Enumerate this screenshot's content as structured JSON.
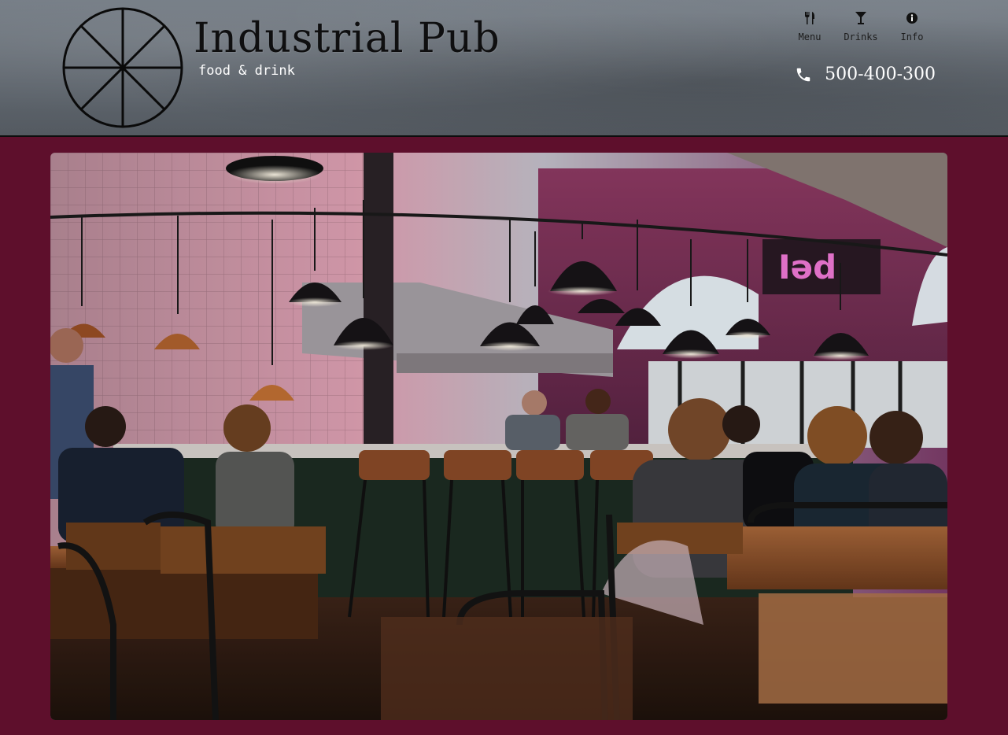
{
  "brand": {
    "title": "Industrial Pub",
    "tagline": "food & drink"
  },
  "nav": {
    "items": [
      {
        "label": "Menu",
        "icon": "utensils-icon"
      },
      {
        "label": "Drinks",
        "icon": "cocktail-glass-icon"
      },
      {
        "label": "Info",
        "icon": "info-circle-icon"
      }
    ]
  },
  "contact": {
    "phone": "500-400-300",
    "icon": "phone-icon"
  },
  "hero": {
    "image": "pub-interior-photo"
  },
  "colors": {
    "page_background": "#5e0f2c",
    "header_background": "#646b73",
    "title_text": "#0f0f10",
    "tagline_text": "#ffffff",
    "phone_text": "#ffffff"
  }
}
